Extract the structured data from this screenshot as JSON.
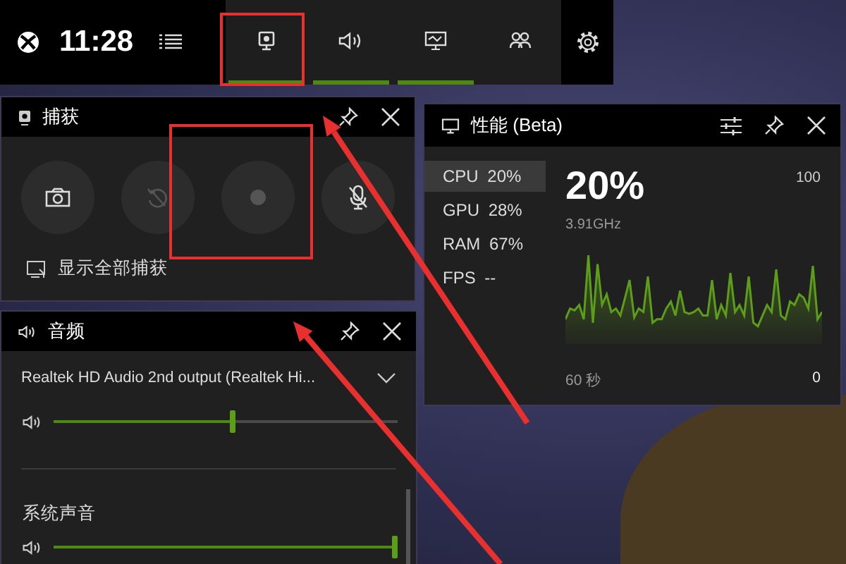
{
  "top_bar": {
    "time": "11:28",
    "tabs": [
      {
        "kind": "capture",
        "on": true
      },
      {
        "kind": "audio",
        "on": true
      },
      {
        "kind": "performance",
        "on": true
      },
      {
        "kind": "social",
        "on": false
      }
    ]
  },
  "capture": {
    "title": "捕获",
    "buttons": [
      {
        "kind": "screenshot",
        "disabled": false
      },
      {
        "kind": "record-last",
        "disabled": true
      },
      {
        "kind": "record",
        "disabled": true
      },
      {
        "kind": "mic-off",
        "disabled": false
      }
    ],
    "show_all_link": "显示全部捕获"
  },
  "audio": {
    "title": "音频",
    "device": {
      "name": "Realtek HD Audio 2nd output (Realtek Hi...",
      "level": 0.53
    },
    "sections": [
      {
        "name": "系统声音",
        "level": 1.0
      }
    ]
  },
  "performance": {
    "title": "性能 (Beta)",
    "metrics": [
      {
        "name": "CPU",
        "value": "20%",
        "selected": true
      },
      {
        "name": "GPU",
        "value": "28%",
        "selected": false
      },
      {
        "name": "RAM",
        "value": "67%",
        "selected": false
      },
      {
        "name": "FPS",
        "value": "--",
        "selected": false
      }
    ],
    "big_value": "20%",
    "sub_value": "3.91GHz",
    "graph": {
      "max_label": "100",
      "min_label": "0",
      "time_span": "60 秒"
    }
  }
}
